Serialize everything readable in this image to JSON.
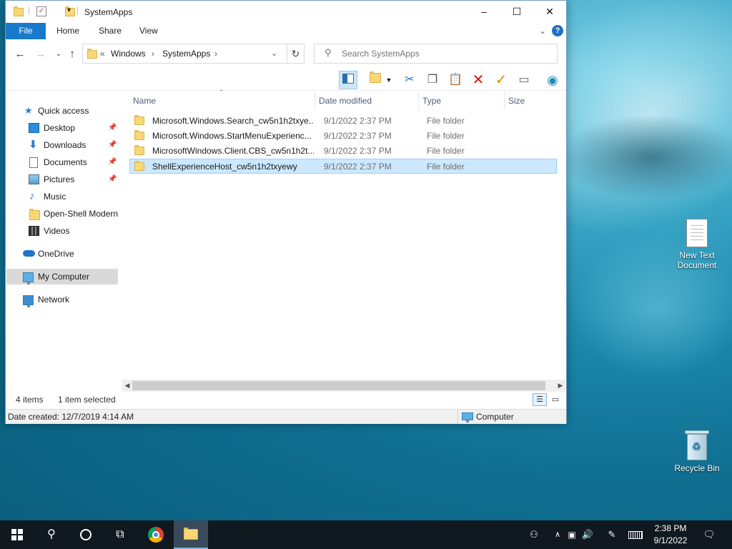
{
  "window": {
    "title": "SystemApps",
    "controls": {
      "minimize": "–",
      "maximize": "☐",
      "close": "✕"
    }
  },
  "ribbon": {
    "tabs": [
      "File",
      "Home",
      "Share",
      "View"
    ],
    "help": "?"
  },
  "address": {
    "overflow": "«",
    "segments": [
      "Windows",
      "SystemApps"
    ],
    "separator": "›",
    "search_placeholder": "Search SystemApps"
  },
  "nav": {
    "quick_access": "Quick access",
    "pinned": [
      {
        "label": "Desktop",
        "icon": "desktop-icon",
        "pinned": true
      },
      {
        "label": "Downloads",
        "icon": "downloads-icon",
        "pinned": true
      },
      {
        "label": "Documents",
        "icon": "documents-icon",
        "pinned": true
      },
      {
        "label": "Pictures",
        "icon": "pictures-icon",
        "pinned": true
      },
      {
        "label": "Music",
        "icon": "music-icon",
        "pinned": false
      },
      {
        "label": "Open-Shell Modern",
        "icon": "folder-icon",
        "pinned": false
      },
      {
        "label": "Videos",
        "icon": "videos-icon",
        "pinned": false
      }
    ],
    "onedrive": "OneDrive",
    "my_computer": "My Computer",
    "network": "Network"
  },
  "columns": {
    "name": "Name",
    "date": "Date modified",
    "type": "Type",
    "size": "Size"
  },
  "files": [
    {
      "name": "Microsoft.Windows.Search_cw5n1h2txye...",
      "date": "9/1/2022 2:37 PM",
      "type": "File folder",
      "selected": false
    },
    {
      "name": "Microsoft.Windows.StartMenuExperienc...",
      "date": "9/1/2022 2:37 PM",
      "type": "File folder",
      "selected": false
    },
    {
      "name": "MicrosoftWindows.Client.CBS_cw5n1h2t...",
      "date": "9/1/2022 2:37 PM",
      "type": "File folder",
      "selected": false
    },
    {
      "name": "ShellExperienceHost_cw5n1h2txyewy",
      "date": "9/1/2022 2:37 PM",
      "type": "File folder",
      "selected": true
    }
  ],
  "status": {
    "items": "4 items",
    "selected": "1 item selected",
    "date_created": "Date created: 12/7/2019 4:14 AM",
    "location": "Computer"
  },
  "desktop": {
    "icons": [
      {
        "label": "New Text Document",
        "icon": "text-document-icon"
      },
      {
        "label": "Recycle Bin",
        "icon": "recycle-bin-icon"
      }
    ]
  },
  "taskbar": {
    "time": "2:38 PM",
    "date": "9/1/2022",
    "items": [
      "start-icon",
      "search-icon",
      "cortana-icon",
      "task-view-icon",
      "chrome-icon",
      "file-explorer-icon"
    ]
  },
  "colors": {
    "accent": "#1979ca",
    "selection": "#cce8ff",
    "taskbar": "#101820"
  }
}
